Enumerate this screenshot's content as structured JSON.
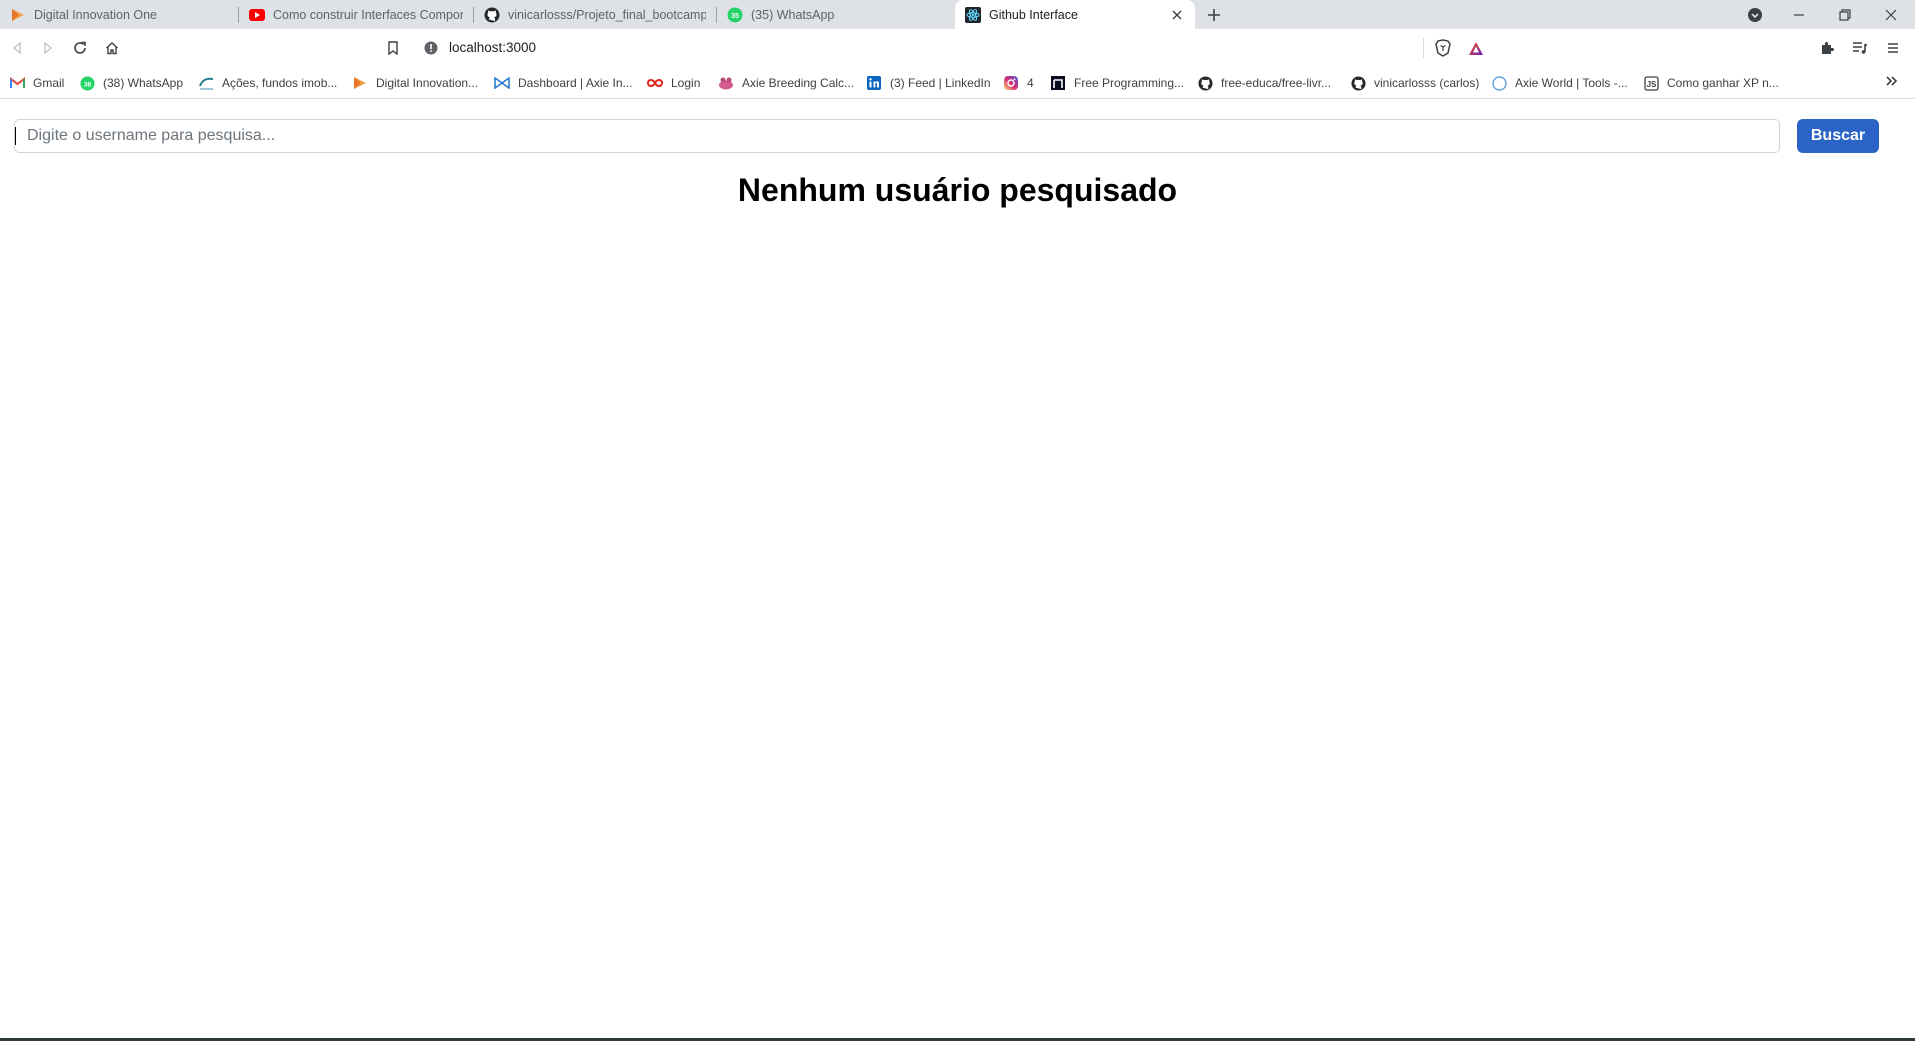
{
  "browser": {
    "tabs": [
      {
        "title": "Digital Innovation One",
        "icon": "dio-icon",
        "active": false
      },
      {
        "title": "Como construir Interfaces Componentizadas",
        "icon": "youtube-icon",
        "active": false
      },
      {
        "title": "vinicarlosss/Projeto_final_bootcamp_N",
        "icon": "github-icon",
        "active": false
      },
      {
        "title": "(35) WhatsApp",
        "icon": "whatsapp-icon",
        "active": false
      },
      {
        "title": "Github Interface",
        "icon": "react-icon",
        "active": true
      }
    ],
    "address_bar": {
      "url": "localhost:3000"
    },
    "bookmarks": [
      {
        "label": "Gmail",
        "icon": "gmail-icon"
      },
      {
        "label": "(38) WhatsApp",
        "icon": "whatsapp-icon"
      },
      {
        "label": "Ações, fundos imob...",
        "icon": "stocks-icon"
      },
      {
        "label": "Digital Innovation...",
        "icon": "dio-icon"
      },
      {
        "label": "Dashboard | Axie In...",
        "icon": "axie-icon"
      },
      {
        "label": "Login",
        "icon": "infinity-icon"
      },
      {
        "label": "Axie Breeding Calc...",
        "icon": "axie-breeding-icon"
      },
      {
        "label": "(3) Feed | LinkedIn",
        "icon": "linkedin-icon"
      },
      {
        "label": "4",
        "icon": "instagram-icon"
      },
      {
        "label": "Free Programming...",
        "icon": "fcc-icon"
      },
      {
        "label": "free-educa/free-livr...",
        "icon": "github-icon"
      },
      {
        "label": "vinicarlosss (carlos)",
        "icon": "github-icon"
      },
      {
        "label": "Axie World | Tools -...",
        "icon": "globe-icon"
      },
      {
        "label": "Como ganhar XP n...",
        "icon": "xp-icon"
      }
    ]
  },
  "app": {
    "search": {
      "placeholder": "Digite o username para pesquisa...",
      "value": ""
    },
    "button_label": "Buscar",
    "empty_message": "Nenhum usuário pesquisado"
  },
  "colors": {
    "accent_button": "#2b64c6",
    "tabstrip": "#dee1e6"
  }
}
